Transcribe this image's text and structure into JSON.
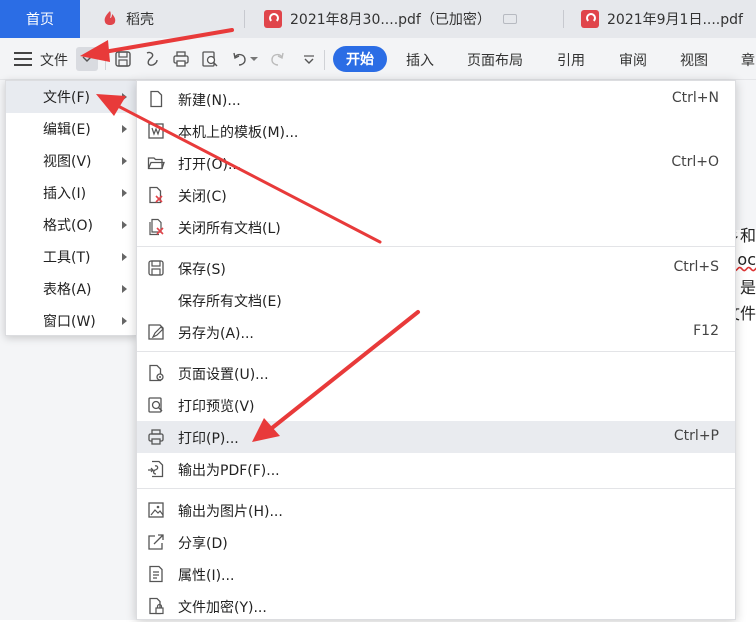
{
  "tabs": {
    "home": "首页",
    "daoke": "稻壳",
    "pdf1": "2021年8月30....pdf（已加密）",
    "pdf2": "2021年9月1日....pdf"
  },
  "toolbar": {
    "file_label": "文件",
    "ribbon": [
      "开始",
      "插入",
      "页面布局",
      "引用",
      "审阅",
      "视图",
      "章"
    ]
  },
  "doc_fragments": [
    "彡和",
    "loc",
    "是",
    "文件"
  ],
  "left_menu": [
    {
      "label": "文件(F)"
    },
    {
      "label": "编辑(E)"
    },
    {
      "label": "视图(V)"
    },
    {
      "label": "插入(I)"
    },
    {
      "label": "格式(O)"
    },
    {
      "label": "工具(T)"
    },
    {
      "label": "表格(A)"
    },
    {
      "label": "窗口(W)"
    }
  ],
  "file_menu": [
    {
      "label": "新建(N)...",
      "shortcut": "Ctrl+N",
      "icon": "new-document-icon"
    },
    {
      "label": "本机上的模板(M)...",
      "shortcut": "",
      "icon": "template-icon"
    },
    {
      "label": "打开(O)...",
      "shortcut": "Ctrl+O",
      "icon": "open-folder-icon"
    },
    {
      "label": "关闭(C)",
      "shortcut": "",
      "icon": "close-document-icon"
    },
    {
      "label": "关闭所有文档(L)",
      "shortcut": "",
      "icon": "close-all-icon"
    },
    {
      "label": "保存(S)",
      "shortcut": "Ctrl+S",
      "icon": "save-icon"
    },
    {
      "label": "保存所有文档(E)",
      "shortcut": "",
      "icon": ""
    },
    {
      "label": "另存为(A)...",
      "shortcut": "F12",
      "icon": "save-as-icon"
    },
    {
      "label": "页面设置(U)...",
      "shortcut": "",
      "icon": "page-setup-icon"
    },
    {
      "label": "打印预览(V)",
      "shortcut": "",
      "icon": "print-preview-icon"
    },
    {
      "label": "打印(P)...",
      "shortcut": "Ctrl+P",
      "icon": "printer-icon"
    },
    {
      "label": "输出为PDF(F)...",
      "shortcut": "",
      "icon": "export-pdf-icon"
    },
    {
      "label": "输出为图片(H)...",
      "shortcut": "",
      "icon": "export-image-icon"
    },
    {
      "label": "分享(D)",
      "shortcut": "",
      "icon": "share-icon"
    },
    {
      "label": "属性(I)...",
      "shortcut": "",
      "icon": "properties-icon"
    },
    {
      "label": "文件加密(Y)...",
      "shortcut": "",
      "icon": "encrypt-icon"
    }
  ],
  "colors": {
    "accent": "#2b6de5",
    "arrow": "#e83a3a",
    "pdf_red": "#e0454b"
  }
}
